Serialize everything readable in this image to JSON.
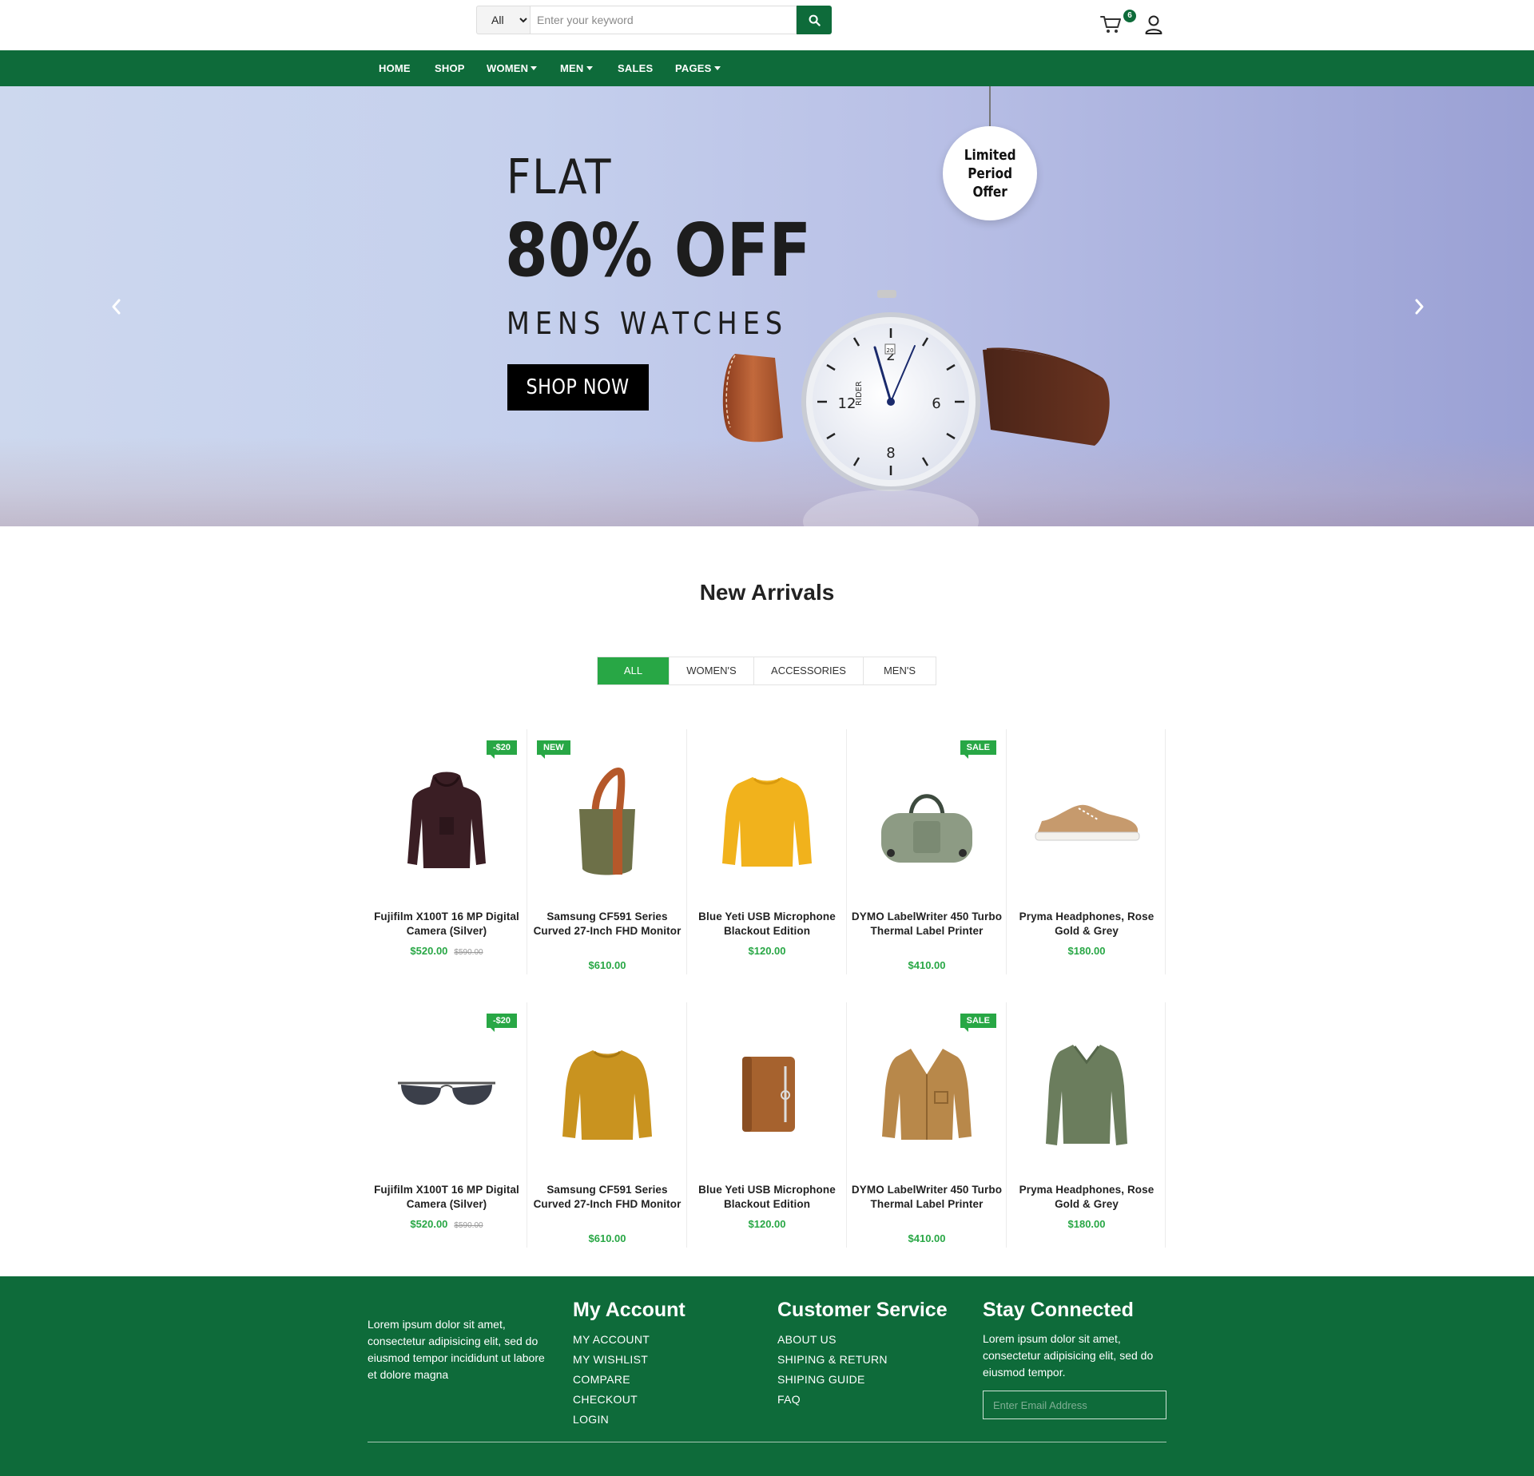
{
  "search": {
    "category_selected": "All",
    "placeholder": "Enter your keyword"
  },
  "cart": {
    "count": "6"
  },
  "nav": {
    "items": [
      {
        "label": "HOME",
        "dropdown": false
      },
      {
        "label": "SHOP",
        "dropdown": false
      },
      {
        "label": "WOMEN",
        "dropdown": true
      },
      {
        "label": "MEN",
        "dropdown": true
      },
      {
        "label": "SALES",
        "dropdown": false
      },
      {
        "label": "PAGES",
        "dropdown": true
      }
    ]
  },
  "hero": {
    "line1": "FLAT",
    "line2": "80% OFF",
    "line3": "MENS WATCHES",
    "button": "SHOP NOW",
    "badge": "Limited\nPeriod\nOffer",
    "watch_brand": "RIDER",
    "watch_date": "20"
  },
  "arrivals": {
    "title": "New Arrivals",
    "tabs": [
      "ALL",
      "WOMEN'S",
      "ACCESSORIES",
      "MEN'S"
    ],
    "active_tab": "ALL",
    "rows": [
      [
        {
          "name": "Fujifilm X100T 16 MP Digital Camera (Silver)",
          "price": "$520.00",
          "old_price": "$590.00",
          "tag": "-$20",
          "image": "hoodie"
        },
        {
          "name": "Samsung CF591 Series Curved 27-Inch FHD Monitor",
          "price": "$610.00",
          "old_price": "",
          "tag": "NEW",
          "image": "tote-bag"
        },
        {
          "name": "Blue Yeti USB Microphone Blackout Edition",
          "price": "$120.00",
          "old_price": "",
          "tag": "",
          "image": "yellow-sweater"
        },
        {
          "name": "DYMO LabelWriter 450 Turbo Thermal Label Printer",
          "price": "$410.00",
          "old_price": "",
          "tag": "SALE",
          "image": "duffel-bag"
        },
        {
          "name": "Pryma Headphones, Rose Gold & Grey",
          "price": "$180.00",
          "old_price": "",
          "tag": "",
          "image": "sneaker"
        }
      ],
      [
        {
          "name": "Fujifilm X100T 16 MP Digital Camera (Silver)",
          "price": "$520.00",
          "old_price": "$590.00",
          "tag": "-$20",
          "image": "sunglasses"
        },
        {
          "name": "Samsung CF591 Series Curved 27-Inch FHD Monitor",
          "price": "$610.00",
          "old_price": "",
          "tag": "",
          "image": "mustard-sweater"
        },
        {
          "name": "Blue Yeti USB Microphone Blackout Edition",
          "price": "$120.00",
          "old_price": "",
          "tag": "",
          "image": "leather-notebook"
        },
        {
          "name": "DYMO LabelWriter 450 Turbo Thermal Label Printer",
          "price": "$410.00",
          "old_price": "",
          "tag": "SALE",
          "image": "cardigan"
        },
        {
          "name": "Pryma Headphones, Rose Gold & Grey",
          "price": "$180.00",
          "old_price": "",
          "tag": "",
          "image": "green-sweater"
        }
      ]
    ]
  },
  "footer": {
    "about": "Lorem ipsum dolor sit amet, consectetur adipisicing elit, sed do eiusmod tempor incididunt ut labore et dolore magna",
    "my_account": {
      "title": "My Account",
      "links": [
        "MY ACCOUNT",
        "MY WISHLIST",
        "COMPARE",
        "CHECKOUT",
        "LOGIN"
      ]
    },
    "customer_service": {
      "title": "Customer Service",
      "links": [
        "ABOUT US",
        "SHIPING & RETURN",
        "SHIPING GUIDE",
        "FAQ"
      ]
    },
    "stay_connected": {
      "title": "Stay Connected",
      "text": "Lorem ipsum dolor sit amet, consectetur adipisicing elit, sed do eiusmod tempor.",
      "email_placeholder": "Enter Email Address"
    }
  },
  "colors": {
    "brand_green": "#0e6b3a",
    "accent_green": "#28a745",
    "text": "#222222"
  }
}
